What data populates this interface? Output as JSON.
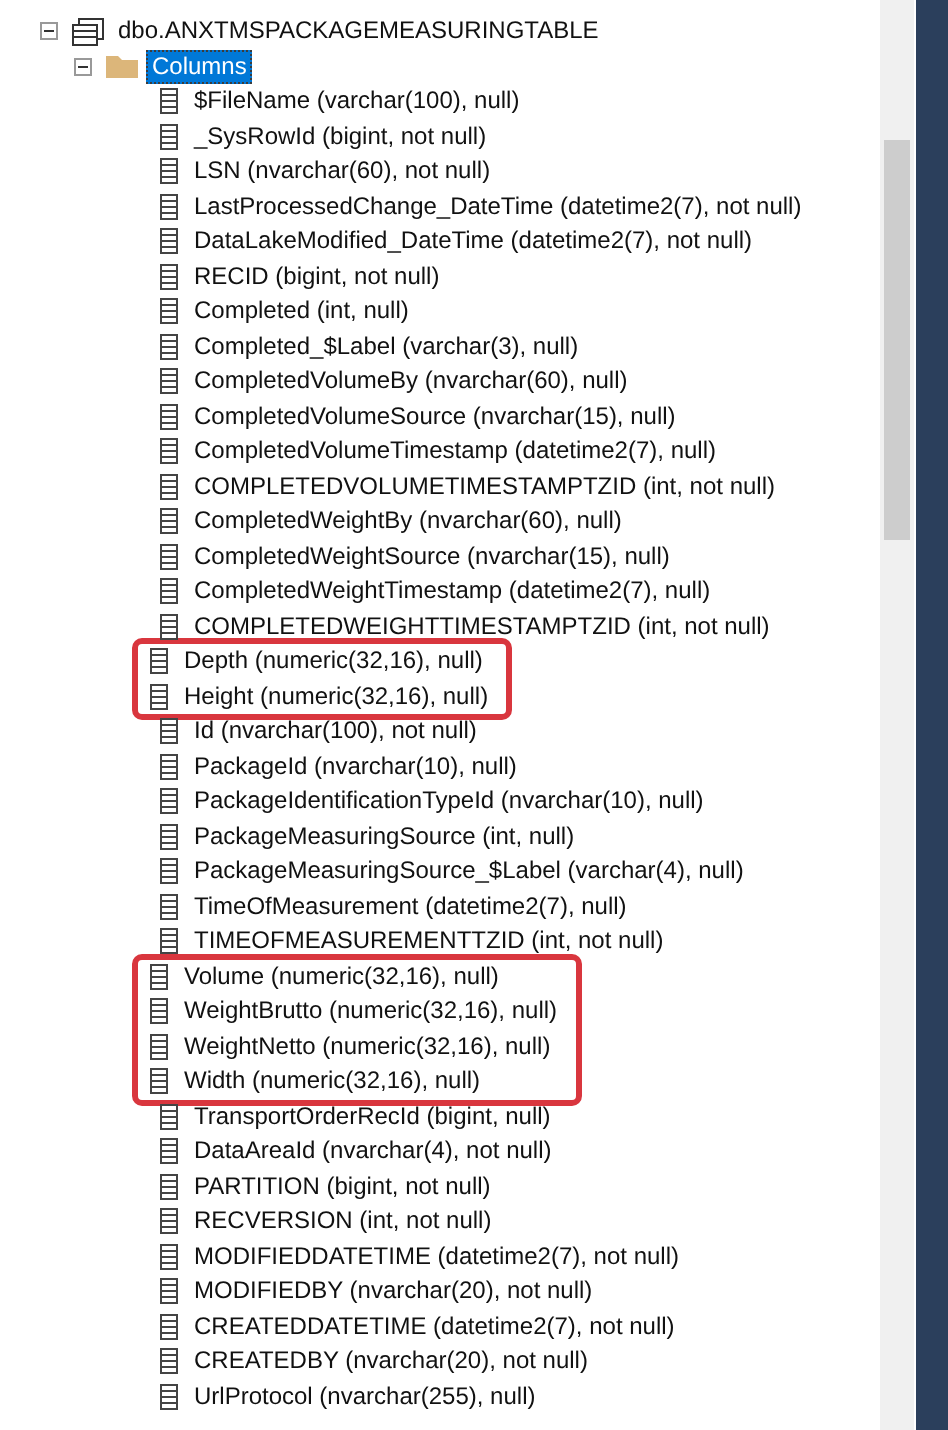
{
  "tree": [
    {
      "label": "dbo.ANXTMSPACKAGEMEASURINGTABLE",
      "kind": "table",
      "expanded": true,
      "selected": false,
      "children": [
        {
          "label": "Columns",
          "kind": "folder",
          "expanded": true,
          "selected": true,
          "children": [
            {
              "label": "$FileName (varchar(100), null)",
              "highlighted": false
            },
            {
              "label": "_SysRowId (bigint, not null)",
              "highlighted": false
            },
            {
              "label": "LSN (nvarchar(60), not null)",
              "highlighted": false
            },
            {
              "label": "LastProcessedChange_DateTime (datetime2(7), not null)",
              "highlighted": false
            },
            {
              "label": "DataLakeModified_DateTime (datetime2(7), not null)",
              "highlighted": false
            },
            {
              "label": "RECID (bigint, not null)",
              "highlighted": false
            },
            {
              "label": "Completed (int, null)",
              "highlighted": false
            },
            {
              "label": "Completed_$Label (varchar(3), null)",
              "highlighted": false
            },
            {
              "label": "CompletedVolumeBy (nvarchar(60), null)",
              "highlighted": false
            },
            {
              "label": "CompletedVolumeSource (nvarchar(15), null)",
              "highlighted": false
            },
            {
              "label": "CompletedVolumeTimestamp (datetime2(7), null)",
              "highlighted": false
            },
            {
              "label": "COMPLETEDVOLUMETIMESTAMPTZID (int, not null)",
              "highlighted": false
            },
            {
              "label": "CompletedWeightBy (nvarchar(60), null)",
              "highlighted": false
            },
            {
              "label": "CompletedWeightSource (nvarchar(15), null)",
              "highlighted": false
            },
            {
              "label": "CompletedWeightTimestamp (datetime2(7), null)",
              "highlighted": false
            },
            {
              "label": "COMPLETEDWEIGHTTIMESTAMPTZID (int, not null)",
              "highlighted": false
            },
            {
              "label": "Depth (numeric(32,16), null)",
              "highlighted": true
            },
            {
              "label": "Height (numeric(32,16), null)",
              "highlighted": true
            },
            {
              "label": "Id (nvarchar(100), not null)",
              "highlighted": false
            },
            {
              "label": "PackageId (nvarchar(10), null)",
              "highlighted": false
            },
            {
              "label": "PackageIdentificationTypeId (nvarchar(10), null)",
              "highlighted": false
            },
            {
              "label": "PackageMeasuringSource (int, null)",
              "highlighted": false
            },
            {
              "label": "PackageMeasuringSource_$Label (varchar(4), null)",
              "highlighted": false
            },
            {
              "label": "TimeOfMeasurement (datetime2(7), null)",
              "highlighted": false
            },
            {
              "label": "TIMEOFMEASUREMENTTZID (int, not null)",
              "highlighted": false
            },
            {
              "label": "Volume (numeric(32,16), null)",
              "highlighted": true
            },
            {
              "label": "WeightBrutto (numeric(32,16), null)",
              "highlighted": true
            },
            {
              "label": "WeightNetto (numeric(32,16), null)",
              "highlighted": true
            },
            {
              "label": "Width (numeric(32,16), null)",
              "highlighted": true
            },
            {
              "label": "TransportOrderRecId (bigint, null)",
              "highlighted": false
            },
            {
              "label": "DataAreaId (nvarchar(4), not null)",
              "highlighted": false
            },
            {
              "label": "PARTITION (bigint, not null)",
              "highlighted": false
            },
            {
              "label": "RECVERSION (int, not null)",
              "highlighted": false
            },
            {
              "label": "MODIFIEDDATETIME (datetime2(7), not null)",
              "highlighted": false
            },
            {
              "label": "MODIFIEDBY (nvarchar(20), not null)",
              "highlighted": false
            },
            {
              "label": "CREATEDDATETIME (datetime2(7), not null)",
              "highlighted": false
            },
            {
              "label": "CREATEDBY (nvarchar(20), not null)",
              "highlighted": false
            },
            {
              "label": "UrlProtocol (nvarchar(255), null)",
              "highlighted": false
            }
          ]
        }
      ]
    }
  ]
}
